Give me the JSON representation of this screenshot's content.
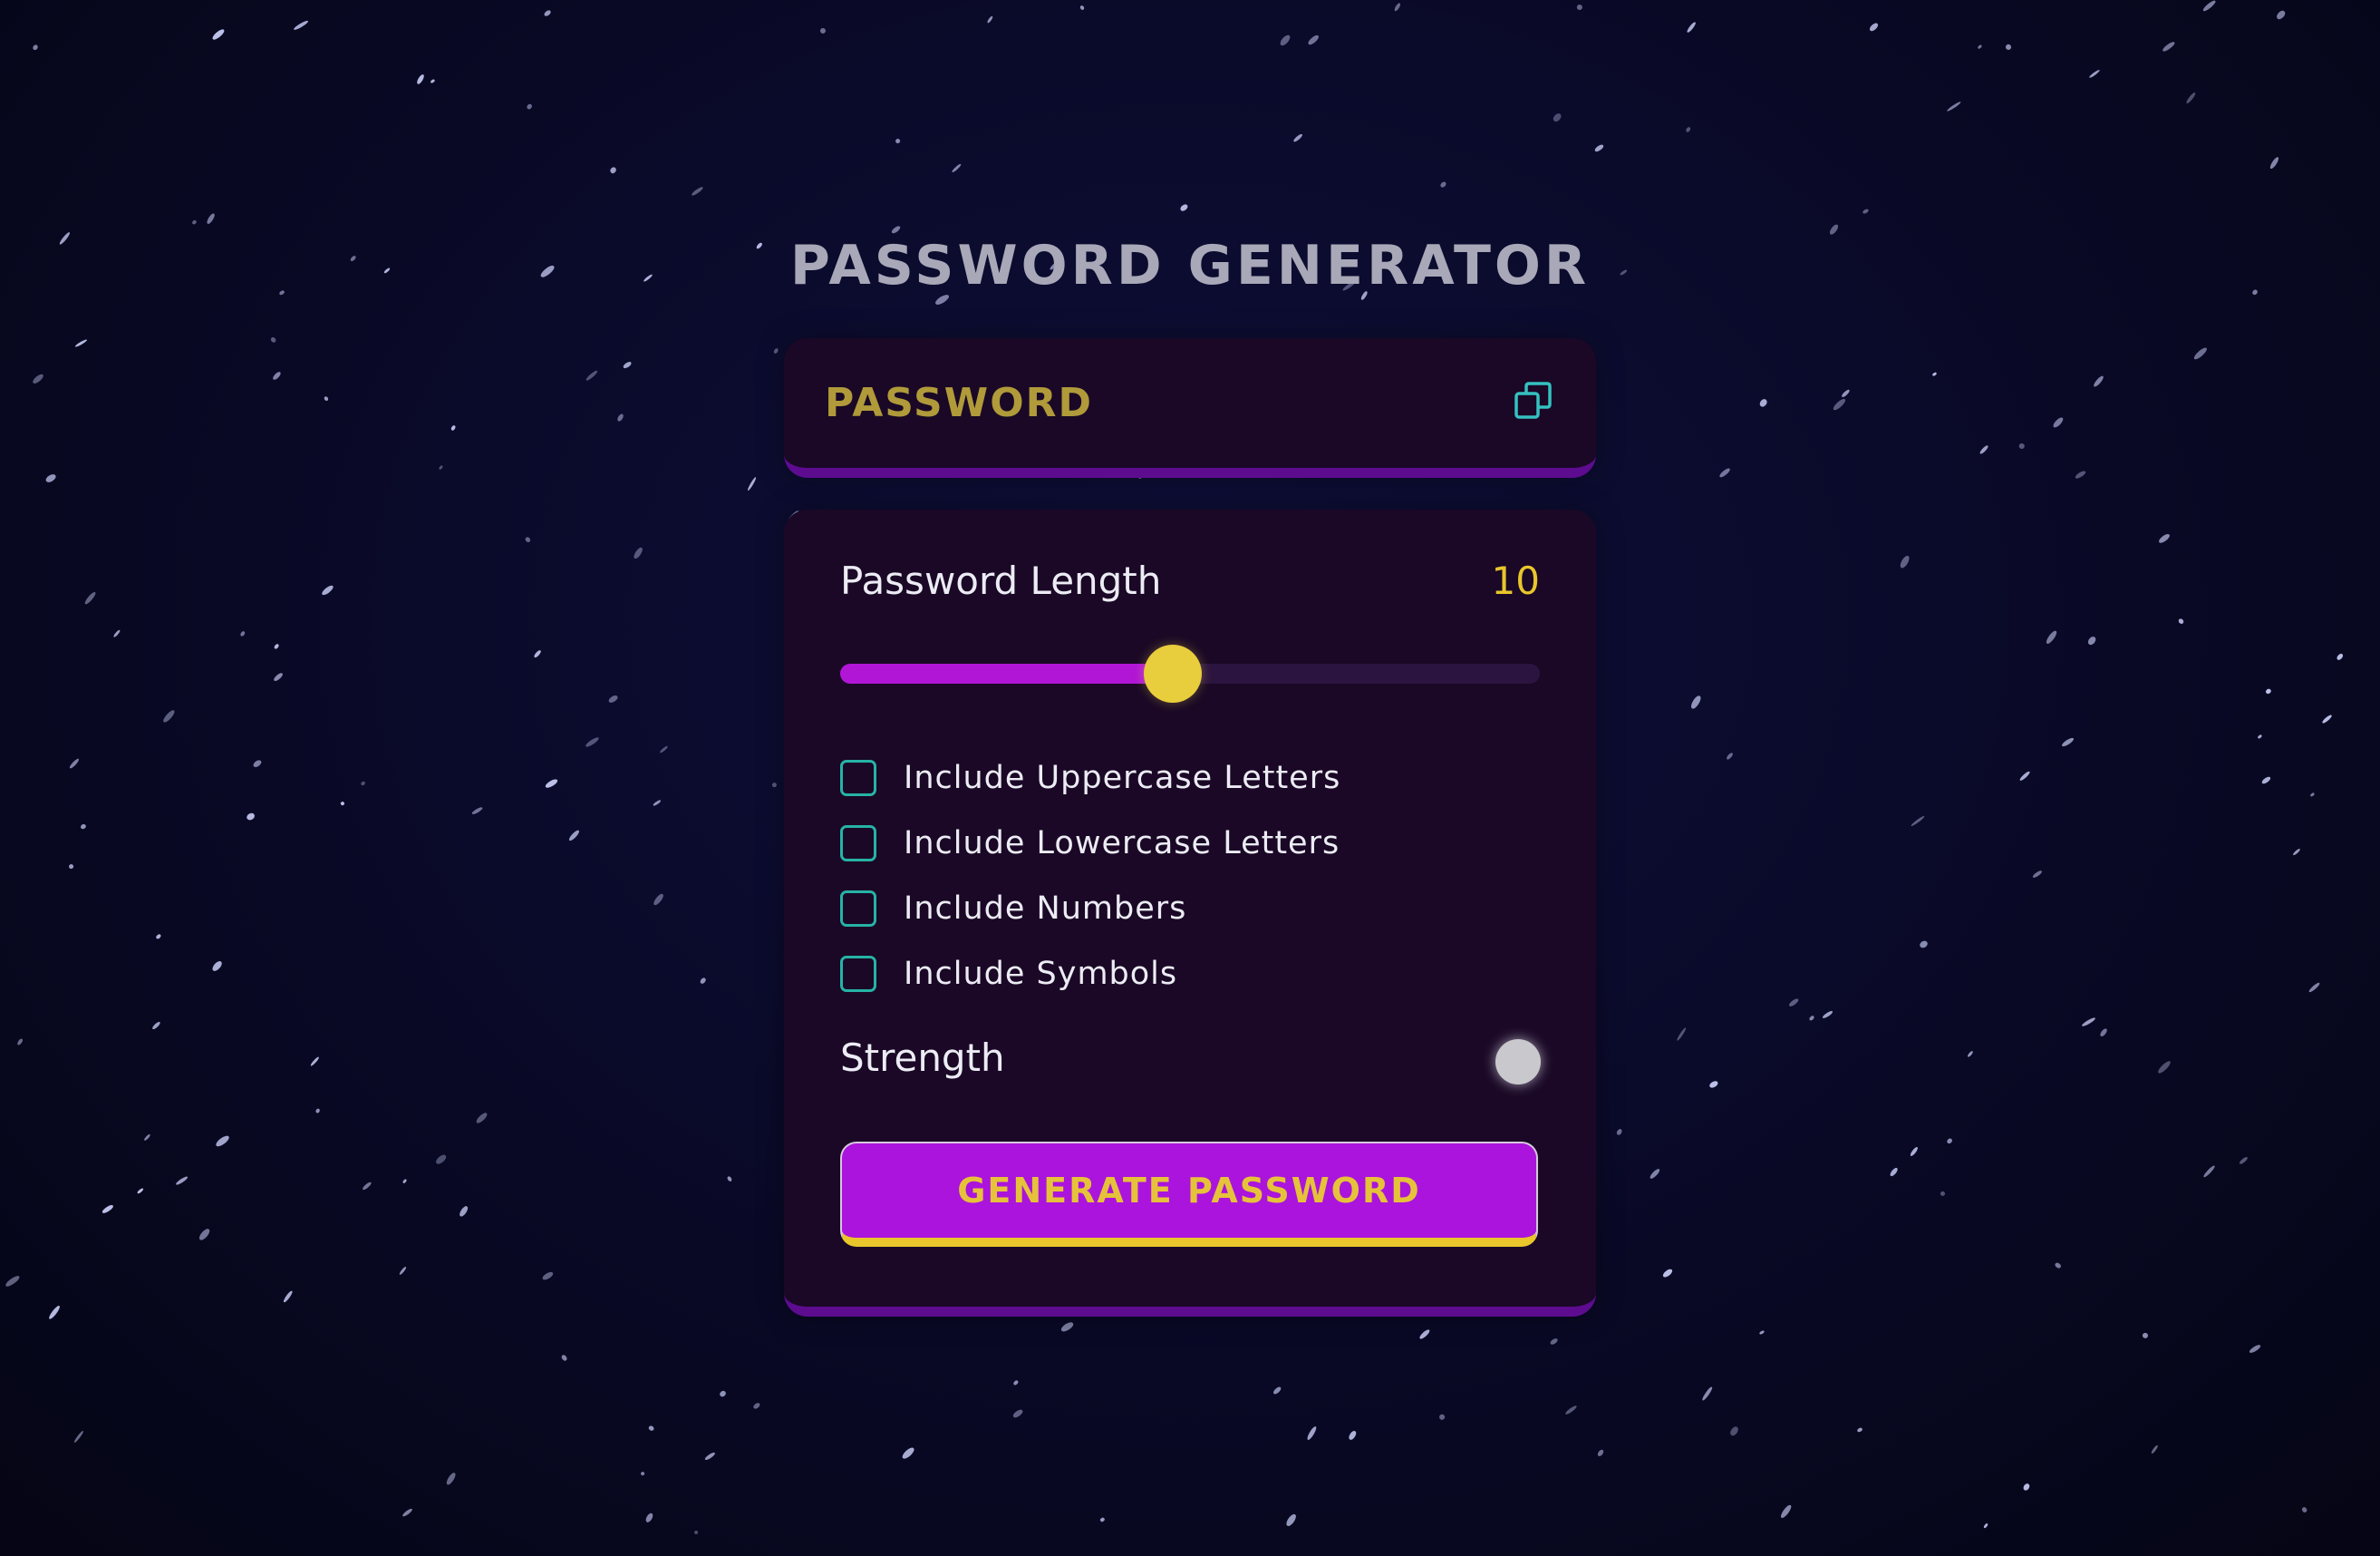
{
  "app": {
    "title": "PASSWORD GENERATOR"
  },
  "display": {
    "password_text": "PASSWORD",
    "copy_icon": "copy-icon"
  },
  "length": {
    "label": "Password Length",
    "value": "10",
    "slider_fraction": 0.475
  },
  "options": [
    {
      "label": "Include Uppercase Letters",
      "checked": false
    },
    {
      "label": "Include Lowercase Letters",
      "checked": false
    },
    {
      "label": "Include Numbers",
      "checked": false
    },
    {
      "label": "Include Symbols",
      "checked": false
    }
  ],
  "strength": {
    "label": "Strength",
    "indicator_color": "#c9c9cd"
  },
  "generate_button": {
    "label": "GENERATE PASSWORD"
  },
  "colors": {
    "accent_purple": "#aa14dc",
    "accent_yellow": "#e8c62c",
    "checkbox_teal": "#26b3a6",
    "panel_bg": "#1a0826"
  }
}
